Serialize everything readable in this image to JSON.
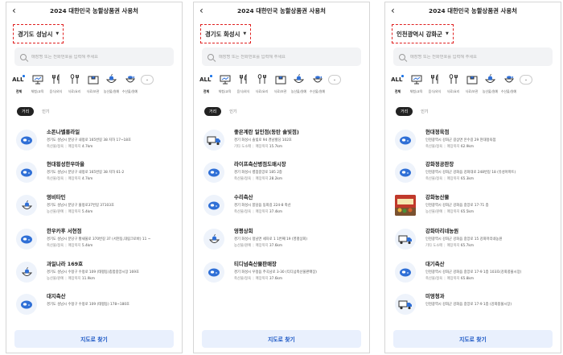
{
  "colors": {
    "accent": "#1a73e8",
    "highlight": "#e02020",
    "icon_blue": "#2f6fd6"
  },
  "categories": [
    {
      "label": "전체",
      "icon": "all-icon"
    },
    {
      "label": "체험/교육",
      "icon": "presentation-icon"
    },
    {
      "label": "음식/외식",
      "icon": "fork-knife-icon"
    },
    {
      "label": "식료/요리",
      "icon": "fork-spoon-icon"
    },
    {
      "label": "식료/보관",
      "icon": "box-icon"
    },
    {
      "label": "농산물/원예",
      "icon": "produce-icon"
    },
    {
      "label": "수산물/원예",
      "icon": "fish-bowl-icon"
    }
  ],
  "screens": [
    {
      "title": "2024 대한민국 농할상품권 사용처",
      "region": "경기도 성남시",
      "search_placeholder": "매장명 또는 전화번호를 입력해 주세요",
      "all_label": "ALL",
      "more_label": "⌄",
      "tabs": {
        "distance": "거리",
        "popular": "인기"
      },
      "stores": [
        {
          "name": "소돈나벨롱라일",
          "addr": "경기도 성남시 분당구 내정로 165번길 38 지하 17~18호",
          "type_label": "축산물/정육",
          "dist_label": "매장까지",
          "dist": "4.7km",
          "icon": "meat-icon"
        },
        {
          "name": "현대횡성한우마을",
          "addr": "경기도 성남시 분당구 내정로 165번길 38 지하 61-2",
          "type_label": "축산물/정육",
          "dist_label": "매장까지",
          "dist": "4.7km",
          "icon": "meat-icon"
        },
        {
          "name": "영비타민",
          "addr": "경기도 성남시 분당구 불정로37번길 37103호",
          "type_label": "농산물/원예",
          "dist_label": "매장까지",
          "dist": "5.4km",
          "icon": "produce-icon"
        },
        {
          "name": "한우카후 서현점",
          "addr": "경기도 성남시 분당구 황새울로 370번길 37 (서현동,대림크로바) 11 ~",
          "type_label": "축산물/정육",
          "dist_label": "매장까지",
          "dist": "5.4km",
          "icon": "meat-icon"
        },
        {
          "name": "과일나라 169호",
          "addr": "경기도 성남시 수정구 수정로 109 (태평동)종합중앙시장 169호",
          "type_label": "농산물/원예",
          "dist_label": "매장까지",
          "dist": "11.9km",
          "icon": "produce-icon"
        },
        {
          "name": "대지축산",
          "addr": "경기도 성남시 수정구 수정로 109 (태평동) 178~180호",
          "type_label": "",
          "dist_label": "",
          "dist": "",
          "icon": "meat-icon"
        }
      ],
      "map_button": "지도로 찾기"
    },
    {
      "title": "2024 대한민국 농할상품권 사용처",
      "region": "경기도 화성시",
      "search_placeholder": "매장명 또는 전화번호를 입력해 주세요",
      "all_label": "ALL",
      "more_label": "⌄",
      "tabs": {
        "distance": "거리",
        "popular": "인기"
      },
      "stores": [
        {
          "name": "좋은계란 일인점(동탄 솔빛점)",
          "addr": "경기 화성시 솔빛로 94 경남빌딩 102호",
          "type_label": "기타 도소매",
          "dist_label": "매장까지",
          "dist": "15.7km",
          "icon": "truck-icon"
        },
        {
          "name": "라이프축산병점도매시장",
          "addr": "경기 화성시 병점중앙로 185 2층",
          "type_label": "축산물/정육",
          "dist_label": "매장까지",
          "dist": "28.2km",
          "icon": "meat-icon"
        },
        {
          "name": "수리축산",
          "addr": "경기 화성시 봉담읍 동화길 224-8 축산",
          "type_label": "축산물/정육",
          "dist_label": "매장까지",
          "dist": "37.4km",
          "icon": "meat-icon"
        },
        {
          "name": "영평상회",
          "addr": "경기 화성시 정남면 세자로 1 1번째 19 (영평상회)",
          "type_label": "농산물/원예",
          "dist_label": "매장까지",
          "dist": "37.6km",
          "icon": "produce-icon"
        },
        {
          "name": "티디넘축산물판매장",
          "addr": "경기 화성시 우정읍 주곡남로 3-30 (티디넘축산물판매장)",
          "type_label": "축산물/정육",
          "dist_label": "매장까지",
          "dist": "37.6km",
          "icon": "meat-icon"
        }
      ],
      "map_button": "지도로 찾기"
    },
    {
      "title": "2024 대한민국 농할상품권 사용처",
      "region": "인천광역시 강화군",
      "search_placeholder": "매장명 또는 전화번호를 입력해 주세요",
      "all_label": "ALL",
      "more_label": "⌄",
      "tabs": {
        "distance": "거리",
        "popular": "인기"
      },
      "stores": [
        {
          "name": "현대정육점",
          "addr": "인천광역시 강화군 길상면 온수길 29 현대정육점",
          "type_label": "축산물/정육",
          "dist_label": "매장까지",
          "dist": "62.9km",
          "icon": "meat-icon"
        },
        {
          "name": "강화정공판장",
          "addr": "인천광역시 강화군 강화읍 강화대로 248번길 18 (유성아파트)",
          "type_label": "축산물/정육",
          "dist_label": "매장까지",
          "dist": "65.3km",
          "icon": "meat-icon"
        },
        {
          "name": "강화농산물",
          "addr": "인천광역시 강화군 강화읍 중앙로 17-71 층",
          "type_label": "농산물/원예",
          "dist_label": "매장까지",
          "dist": "65.5km",
          "icon": "photo"
        },
        {
          "name": "강화마리네농원",
          "addr": "인천광역시 강화군 강화읍 중앙로 15 강화마리네농원",
          "type_label": "기타 도소매",
          "dist_label": "매장까지",
          "dist": "65.7km",
          "icon": "truck-icon"
        },
        {
          "name": "대기축산",
          "addr": "인천광역시 강화군 강화읍 중앙로 17-9 1층 103호(강화풍물시장)",
          "type_label": "축산물/정육",
          "dist_label": "매장까지",
          "dist": "65.8km",
          "icon": "meat-icon"
        },
        {
          "name": "미영청과",
          "addr": "인천광역시 강화군 강화읍 중앙로 17-9 1층 (강화풍물시장)",
          "type_label": "",
          "dist_label": "",
          "dist": "",
          "icon": "truck-icon"
        }
      ],
      "map_button": "지도로 찾기"
    }
  ]
}
